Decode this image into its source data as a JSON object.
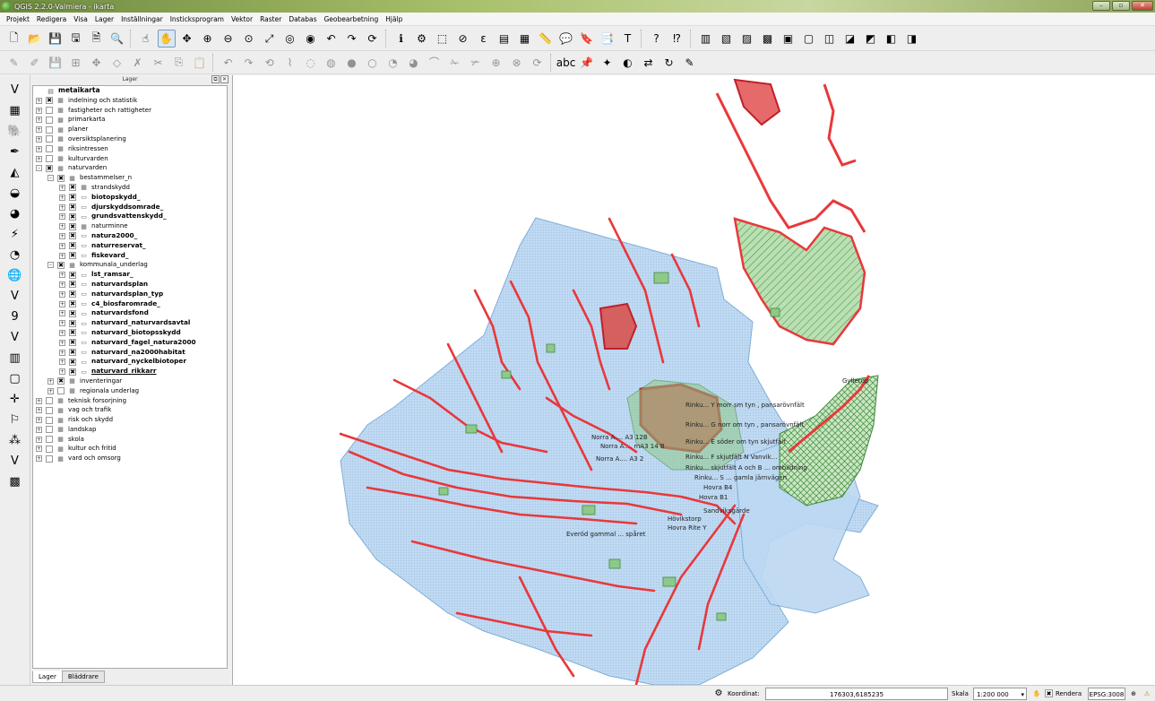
{
  "window": {
    "title": "QGIS 2.2.0-Valmiera - ikarta",
    "min": "–",
    "max": "▫",
    "close": "✕"
  },
  "menu": [
    "Projekt",
    "Redigera",
    "Visa",
    "Lager",
    "Inställningar",
    "Insticksprogram",
    "Vektor",
    "Raster",
    "Databas",
    "Geobearbetning",
    "Hjälp"
  ],
  "layers_panel": {
    "title": "Lager",
    "float_btn": "⧉",
    "close_btn": "✕",
    "tabs": [
      "Lager",
      "Bläddrare"
    ],
    "tree": [
      {
        "label": "metaikarta",
        "level": 0,
        "kind": "root",
        "exp": "",
        "chk": "",
        "icon": "▤"
      },
      {
        "label": "indelning och statistik",
        "level": 1,
        "kind": "group",
        "exp": "+",
        "chk": "✖",
        "icon": "▦"
      },
      {
        "label": "fastigheter och rattigheter",
        "level": 1,
        "kind": "group",
        "exp": "+",
        "chk": "",
        "icon": "▦"
      },
      {
        "label": "primarkarta",
        "level": 1,
        "kind": "group",
        "exp": "+",
        "chk": "",
        "icon": "▦"
      },
      {
        "label": "planer",
        "level": 1,
        "kind": "group",
        "exp": "+",
        "chk": "",
        "icon": "▦"
      },
      {
        "label": "oversiktsplanering",
        "level": 1,
        "kind": "group",
        "exp": "+",
        "chk": "",
        "icon": "▦"
      },
      {
        "label": "riksintressen",
        "level": 1,
        "kind": "group",
        "exp": "+",
        "chk": "",
        "icon": "▦"
      },
      {
        "label": "kulturvarden",
        "level": 1,
        "kind": "group",
        "exp": "+",
        "chk": "",
        "icon": "▦"
      },
      {
        "label": "naturvarden",
        "level": 1,
        "kind": "group",
        "exp": "–",
        "chk": "✖",
        "icon": "▦"
      },
      {
        "label": "bestammelser_n",
        "level": 2,
        "kind": "group",
        "exp": "–",
        "chk": "✖",
        "icon": "▦"
      },
      {
        "label": "strandskydd",
        "level": 3,
        "kind": "group",
        "exp": "+",
        "chk": "✖",
        "icon": "▦"
      },
      {
        "label": "biotopskydd_",
        "level": 3,
        "kind": "bold",
        "exp": "+",
        "chk": "✖",
        "icon": "▭"
      },
      {
        "label": "djurskyddsomrade_",
        "level": 3,
        "kind": "bold",
        "exp": "+",
        "chk": "✖",
        "icon": "▭"
      },
      {
        "label": "grundsvattenskydd_",
        "level": 3,
        "kind": "bold",
        "exp": "+",
        "chk": "✖",
        "icon": "▭"
      },
      {
        "label": "naturminne",
        "level": 3,
        "kind": "group",
        "exp": "+",
        "chk": "✖",
        "icon": "▦"
      },
      {
        "label": "natura2000_",
        "level": 3,
        "kind": "bold",
        "exp": "+",
        "chk": "✖",
        "icon": "▭"
      },
      {
        "label": "naturreservat_",
        "level": 3,
        "kind": "bold",
        "exp": "+",
        "chk": "✖",
        "icon": "▭"
      },
      {
        "label": "fiskevard_",
        "level": 3,
        "kind": "bold",
        "exp": "+",
        "chk": "✖",
        "icon": "▭"
      },
      {
        "label": "kommunala_underlag",
        "level": 2,
        "kind": "group",
        "exp": "–",
        "chk": "✖",
        "icon": "▦"
      },
      {
        "label": "lst_ramsar_",
        "level": 3,
        "kind": "bold",
        "exp": "+",
        "chk": "✖",
        "icon": "▭"
      },
      {
        "label": "naturvardsplan",
        "level": 3,
        "kind": "bold",
        "exp": "+",
        "chk": "✖",
        "icon": "▭"
      },
      {
        "label": "naturvardsplan_typ",
        "level": 3,
        "kind": "bold",
        "exp": "+",
        "chk": "✖",
        "icon": "▭"
      },
      {
        "label": "c4_biosfaromrade_",
        "level": 3,
        "kind": "bold",
        "exp": "+",
        "chk": "✖",
        "icon": "▭"
      },
      {
        "label": "naturvardsfond",
        "level": 3,
        "kind": "bold",
        "exp": "+",
        "chk": "✖",
        "icon": "▭"
      },
      {
        "label": "naturvard_naturvardsavtal",
        "level": 3,
        "kind": "bold",
        "exp": "+",
        "chk": "✖",
        "icon": "▭"
      },
      {
        "label": "naturvard_biotopsskydd",
        "level": 3,
        "kind": "bold",
        "exp": "+",
        "chk": "✖",
        "icon": "▭"
      },
      {
        "label": "naturvard_fagel_natura2000",
        "level": 3,
        "kind": "bold",
        "exp": "+",
        "chk": "✖",
        "icon": "▭"
      },
      {
        "label": "naturvard_na2000habitat",
        "level": 3,
        "kind": "bold",
        "exp": "+",
        "chk": "✖",
        "icon": "▭"
      },
      {
        "label": "naturvard_nyckelbiotoper",
        "level": 3,
        "kind": "bold",
        "exp": "+",
        "chk": "✖",
        "icon": "▭"
      },
      {
        "label": "naturvard_rikkarr",
        "level": 3,
        "kind": "boldul",
        "exp": "+",
        "chk": "✖",
        "icon": "▭"
      },
      {
        "label": "inventeringar",
        "level": 2,
        "kind": "group",
        "exp": "+",
        "chk": "✖",
        "icon": "▦"
      },
      {
        "label": "regionala underlag",
        "level": 2,
        "kind": "group",
        "exp": "+",
        "chk": "",
        "icon": "▦"
      },
      {
        "label": "teknisk forsorjning",
        "level": 1,
        "kind": "group",
        "exp": "+",
        "chk": "",
        "icon": "▦"
      },
      {
        "label": "vag och trafik",
        "level": 1,
        "kind": "group",
        "exp": "+",
        "chk": "",
        "icon": "▦"
      },
      {
        "label": "risk och skydd",
        "level": 1,
        "kind": "group",
        "exp": "+",
        "chk": "",
        "icon": "▦"
      },
      {
        "label": "landskap",
        "level": 1,
        "kind": "group",
        "exp": "+",
        "chk": "",
        "icon": "▦"
      },
      {
        "label": "skola",
        "level": 1,
        "kind": "group",
        "exp": "+",
        "chk": "",
        "icon": "▦"
      },
      {
        "label": "kultur och fritid",
        "level": 1,
        "kind": "group",
        "exp": "+",
        "chk": "",
        "icon": "▦"
      },
      {
        "label": "vard och omsorg",
        "level": 1,
        "kind": "group",
        "exp": "+",
        "chk": "",
        "icon": "▦"
      }
    ]
  },
  "toolbar1": [
    {
      "name": "new-project-icon",
      "glyph": "🗋"
    },
    {
      "name": "open-project-icon",
      "glyph": "📂"
    },
    {
      "name": "save-project-icon",
      "glyph": "💾"
    },
    {
      "name": "save-as-icon",
      "glyph": "🖫"
    },
    {
      "name": "new-print-composer-icon",
      "glyph": "🗎"
    },
    {
      "name": "composer-manager-icon",
      "glyph": "🔍"
    },
    {
      "sep": true
    },
    {
      "name": "touch-zoom-icon",
      "glyph": "☝"
    },
    {
      "name": "pan-map-icon",
      "glyph": "✋",
      "active": true
    },
    {
      "name": "pan-to-selection-icon",
      "glyph": "✥"
    },
    {
      "name": "zoom-in-icon",
      "glyph": "⊕"
    },
    {
      "name": "zoom-out-icon",
      "glyph": "⊖"
    },
    {
      "name": "zoom-actual-icon",
      "glyph": "⊙"
    },
    {
      "name": "zoom-full-icon",
      "glyph": "⤢"
    },
    {
      "name": "zoom-selection-icon",
      "glyph": "◎"
    },
    {
      "name": "zoom-layer-icon",
      "glyph": "◉"
    },
    {
      "name": "zoom-last-icon",
      "glyph": "↶"
    },
    {
      "name": "zoom-next-icon",
      "glyph": "↷"
    },
    {
      "name": "refresh-icon",
      "glyph": "⟳"
    },
    {
      "sep": true
    },
    {
      "name": "identify-icon",
      "glyph": "ℹ"
    },
    {
      "name": "action-icon",
      "glyph": "⚙"
    },
    {
      "name": "select-feature-icon",
      "glyph": "⬚"
    },
    {
      "name": "deselect-icon",
      "glyph": "⊘"
    },
    {
      "name": "select-expression-icon",
      "glyph": "ε"
    },
    {
      "name": "attribute-table-icon",
      "glyph": "▤"
    },
    {
      "name": "field-calculator-icon",
      "glyph": "▦"
    },
    {
      "name": "measure-icon",
      "glyph": "📏"
    },
    {
      "name": "map-tips-icon",
      "glyph": "💬"
    },
    {
      "name": "new-bookmark-icon",
      "glyph": "🔖"
    },
    {
      "name": "show-bookmarks-icon",
      "glyph": "📑"
    },
    {
      "name": "text-annotation-icon",
      "glyph": "T"
    },
    {
      "sep": true
    },
    {
      "name": "help-icon",
      "glyph": "?"
    },
    {
      "name": "whats-this-icon",
      "glyph": "⁉"
    },
    {
      "sep": true
    },
    {
      "name": "add-vector-layer-icon",
      "glyph": "▥"
    },
    {
      "name": "add-raster-layer-icon",
      "glyph": "▧"
    },
    {
      "name": "add-postgis-layer-icon",
      "glyph": "▨"
    },
    {
      "name": "add-spatialite-layer-icon",
      "glyph": "▩"
    },
    {
      "name": "add-mssql-layer-icon",
      "glyph": "▣"
    },
    {
      "name": "add-oracle-layer-icon",
      "glyph": "▢"
    },
    {
      "name": "add-wms-layer-icon",
      "glyph": "◫"
    },
    {
      "name": "add-wcs-layer-icon",
      "glyph": "◪"
    },
    {
      "name": "add-wfs-layer-icon",
      "glyph": "◩"
    },
    {
      "name": "new-shapefile-icon",
      "glyph": "◧"
    },
    {
      "name": "new-spatialite-icon",
      "glyph": "◨"
    }
  ],
  "toolbar2": [
    {
      "name": "toggle-editing-icon",
      "glyph": "✎",
      "dim": true
    },
    {
      "name": "current-edits-icon",
      "glyph": "✐",
      "dim": true
    },
    {
      "name": "save-edits-icon",
      "glyph": "💾",
      "dim": true
    },
    {
      "name": "add-feature-icon",
      "glyph": "⊞",
      "dim": true
    },
    {
      "name": "move-feature-icon",
      "glyph": "✥",
      "dim": true
    },
    {
      "name": "node-tool-icon",
      "glyph": "◇",
      "dim": true
    },
    {
      "name": "delete-selected-icon",
      "glyph": "✗",
      "dim": true
    },
    {
      "name": "cut-features-icon",
      "glyph": "✂",
      "dim": true
    },
    {
      "name": "copy-features-icon",
      "glyph": "⎘",
      "dim": true
    },
    {
      "name": "paste-features-icon",
      "glyph": "📋",
      "dim": true
    },
    {
      "sep": true
    },
    {
      "name": "undo-icon",
      "glyph": "↶",
      "dim": true
    },
    {
      "name": "redo-icon",
      "glyph": "↷",
      "dim": true
    },
    {
      "name": "rotate-feature-icon",
      "glyph": "⟲",
      "dim": true
    },
    {
      "name": "simplify-feature-icon",
      "glyph": "⌇",
      "dim": true
    },
    {
      "name": "add-ring-icon",
      "glyph": "◌",
      "dim": true
    },
    {
      "name": "add-part-icon",
      "glyph": "◍",
      "dim": true
    },
    {
      "name": "fill-ring-icon",
      "glyph": "●",
      "dim": true
    },
    {
      "name": "delete-ring-icon",
      "glyph": "○",
      "dim": true
    },
    {
      "name": "delete-part-icon",
      "glyph": "◔",
      "dim": true
    },
    {
      "name": "reshape-features-icon",
      "glyph": "◕",
      "dim": true
    },
    {
      "name": "offset-curve-icon",
      "glyph": "⌒",
      "dim": true
    },
    {
      "name": "split-features-icon",
      "glyph": "✁",
      "dim": true
    },
    {
      "name": "split-parts-icon",
      "glyph": "✃",
      "dim": true
    },
    {
      "name": "merge-selected-icon",
      "glyph": "⊕",
      "dim": true
    },
    {
      "name": "merge-attributes-icon",
      "glyph": "⊗",
      "dim": true
    },
    {
      "name": "rotate-point-icon",
      "glyph": "⟳",
      "dim": true
    },
    {
      "sep": true
    },
    {
      "name": "label-tool-icon",
      "glyph": "abc"
    },
    {
      "name": "pin-labels-icon",
      "glyph": "📌"
    },
    {
      "name": "highlight-pinned-icon",
      "glyph": "✦"
    },
    {
      "name": "show-hide-labels-icon",
      "glyph": "◐"
    },
    {
      "name": "move-label-icon",
      "glyph": "⇄"
    },
    {
      "name": "rotate-label-icon",
      "glyph": "↻"
    },
    {
      "name": "change-label-icon",
      "glyph": "✎"
    }
  ],
  "lefttools": [
    {
      "name": "add-vector-layer-icon",
      "glyph": "V"
    },
    {
      "name": "add-raster-layer-icon",
      "glyph": "▦"
    },
    {
      "name": "add-postgis-layer-icon",
      "glyph": "🐘"
    },
    {
      "name": "add-spatialite-layer-icon",
      "glyph": "✒"
    },
    {
      "name": "add-mssql-layer-icon",
      "glyph": "◭"
    },
    {
      "name": "add-oracle-layer-icon",
      "glyph": "◒"
    },
    {
      "name": "add-wms-layer-icon",
      "glyph": "◕"
    },
    {
      "name": "add-wcs-layer-icon",
      "glyph": "⚡"
    },
    {
      "name": "add-wfs-layer-icon",
      "glyph": "◔"
    },
    {
      "name": "add-wfs-layer-2-icon",
      "glyph": "🌐"
    },
    {
      "name": "add-delimited-text-icon",
      "glyph": "V"
    },
    {
      "name": "add-gps-layer-icon",
      "glyph": "9"
    },
    {
      "name": "new-shapefile-icon",
      "glyph": "V"
    },
    {
      "name": "new-spatialite-icon",
      "glyph": "▥"
    },
    {
      "name": "new-temp-layer-icon",
      "glyph": "▢"
    },
    {
      "name": "gps-tool-icon",
      "glyph": "✛"
    },
    {
      "name": "coordinate-capture-icon",
      "glyph": "⚐"
    },
    {
      "name": "point-tool-icon",
      "glyph": "⁂"
    },
    {
      "name": "vector-tool-icon",
      "glyph": "V"
    },
    {
      "name": "georeferencer-icon",
      "glyph": "▩"
    }
  ],
  "map": {
    "labels": [
      "Norra A.... A3 12B",
      "Norra A.... mA3 14 B",
      "Norra A.... A3 2",
      "Rinku... Y morr sm tyn , pansarövnfält",
      "Rinku... G norr om tyn , pansarövnfält",
      "Rinku... E söder om tyn skjutfält",
      "Rinku... F skjutfält N Vanvik...",
      "Rinku... skjutfält A och B ... ombildning",
      "Rinku... S ... gamla järnvägen",
      "Hovra B4",
      "Hovra B1",
      "Sandviksgärde",
      "Hövikstorp",
      "Hovra Rite Y",
      "Everöd gammal ... spåret",
      "Gyllerup"
    ]
  },
  "status": {
    "coord_label": "Koordinat:",
    "coord_value": "176303,6185235",
    "scale_label": "Skala",
    "scale_value": "1:200 000",
    "render_label": "Rendera",
    "render_check": "✖",
    "crs": "EPSG:3008"
  },
  "colors": {
    "water_blue": "#bcd8f2",
    "water_edge": "#7aa9d6",
    "red_line": "#e8383b",
    "red_dark": "#c0202a",
    "green_fill": "#8fc98a",
    "green_dark": "#3f8a3c"
  }
}
